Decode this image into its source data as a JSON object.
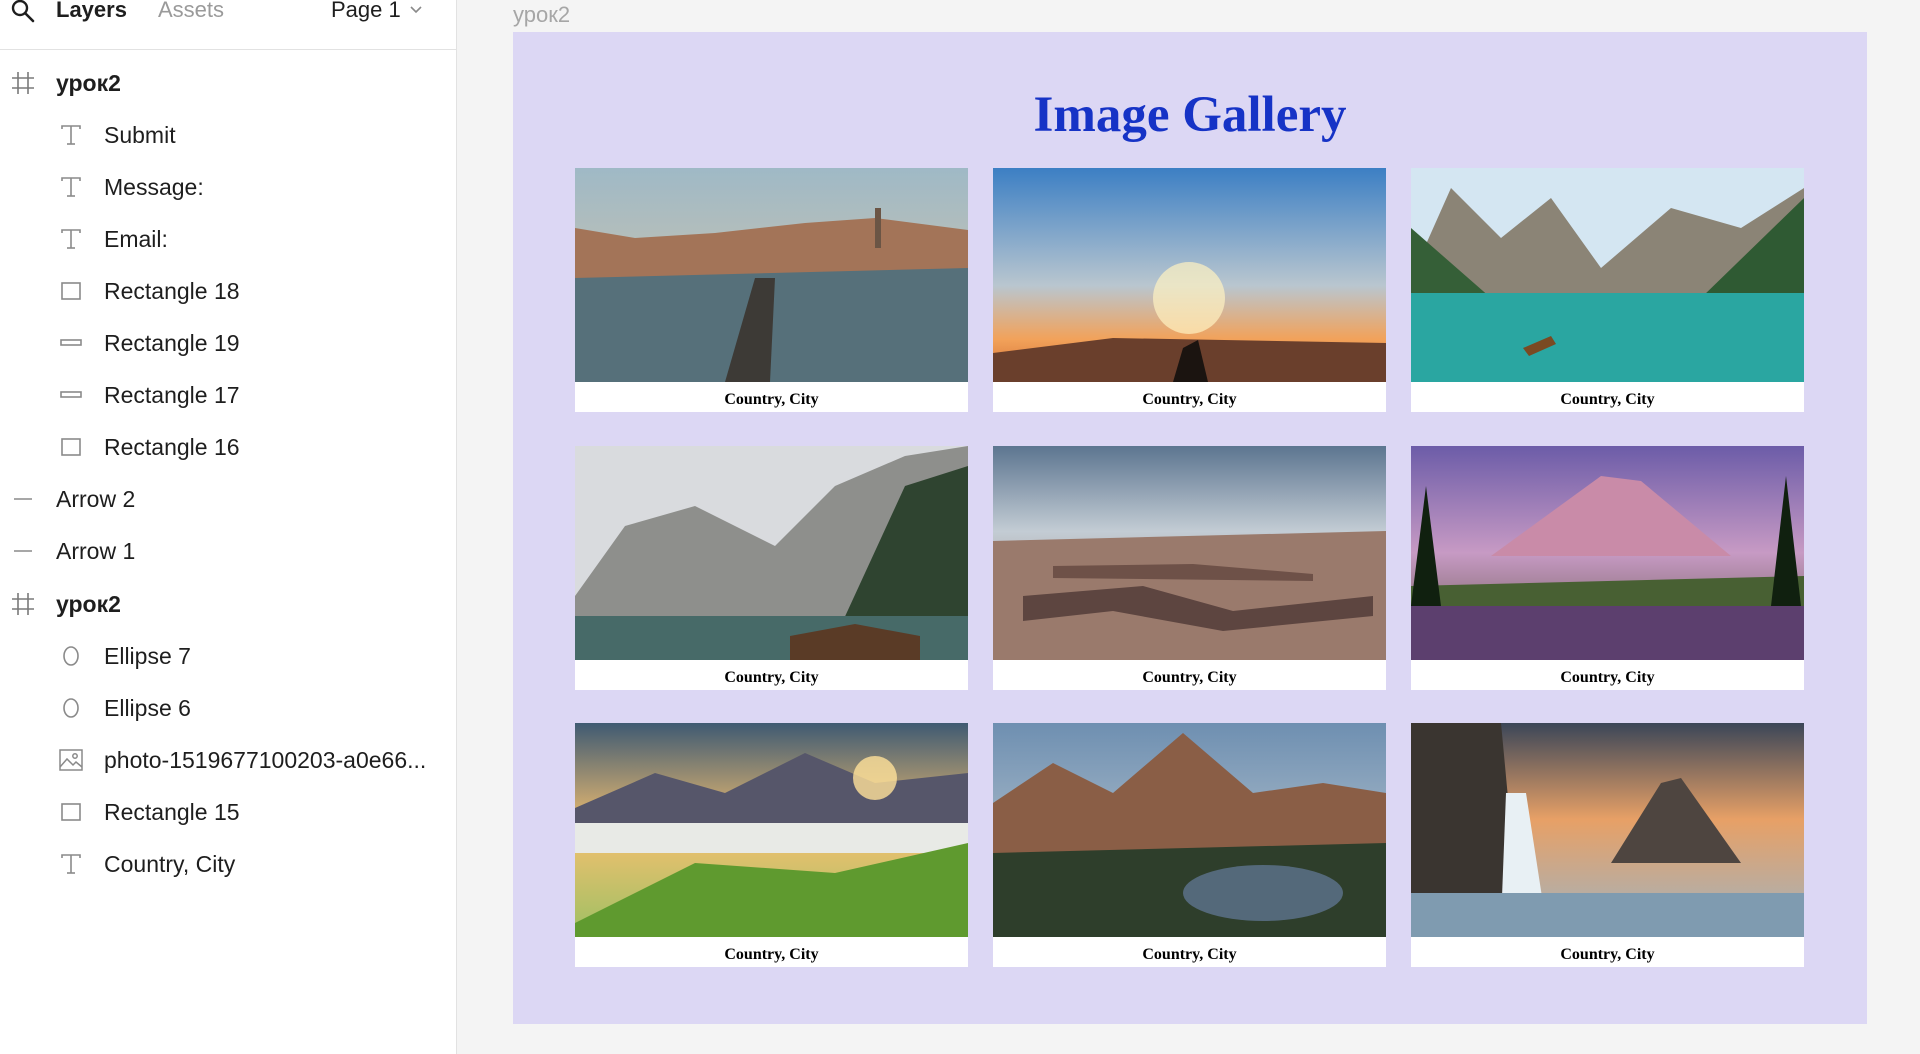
{
  "panel": {
    "tab_layers": "Layers",
    "tab_assets": "Assets",
    "page_label": "Page 1"
  },
  "layers": [
    {
      "label": "урок2",
      "icon": "frame-icon"
    },
    {
      "label": "Submit",
      "icon": "text-icon"
    },
    {
      "label": "Message:",
      "icon": "text-icon"
    },
    {
      "label": "Email:",
      "icon": "text-icon"
    },
    {
      "label": "Rectangle 18",
      "icon": "rectangle-icon"
    },
    {
      "label": "Rectangle 19",
      "icon": "line-icon"
    },
    {
      "label": "Rectangle 17",
      "icon": "line-icon"
    },
    {
      "label": "Rectangle 16",
      "icon": "rectangle-icon"
    },
    {
      "label": "Arrow 2",
      "icon": "arrow-line-icon"
    },
    {
      "label": "Arrow 1",
      "icon": "arrow-line-icon"
    },
    {
      "label": "урок2",
      "icon": "frame-icon"
    },
    {
      "label": "Ellipse 7",
      "icon": "ellipse-icon"
    },
    {
      "label": "Ellipse 6",
      "icon": "ellipse-icon"
    },
    {
      "label": "photo-1519677100203-a0e66...",
      "icon": "image-icon"
    },
    {
      "label": "Rectangle 15",
      "icon": "rectangle-icon"
    },
    {
      "label": "Country, City",
      "icon": "text-icon"
    }
  ],
  "canvas": {
    "frame_name": "урок2",
    "background": "#dcd7f4",
    "title": "Image Gallery",
    "title_color": "#1633c6",
    "cards": [
      {
        "caption": "Country, City",
        "image": "prague-bridge-photo"
      },
      {
        "caption": "Country, City",
        "image": "sunset-silhouette-photo"
      },
      {
        "caption": "Country, City",
        "image": "alpine-lake-boat-photo"
      },
      {
        "caption": "Country, City",
        "image": "mountain-lake-cabin-photo"
      },
      {
        "caption": "Country, City",
        "image": "canyon-landscape-photo"
      },
      {
        "caption": "Country, City",
        "image": "mountain-reflection-photo"
      },
      {
        "caption": "Country, City",
        "image": "green-hills-sunrise-photo"
      },
      {
        "caption": "Country, City",
        "image": "mountain-valley-lake-photo"
      },
      {
        "caption": "Country, City",
        "image": "waterfall-mountain-photo"
      }
    ]
  }
}
